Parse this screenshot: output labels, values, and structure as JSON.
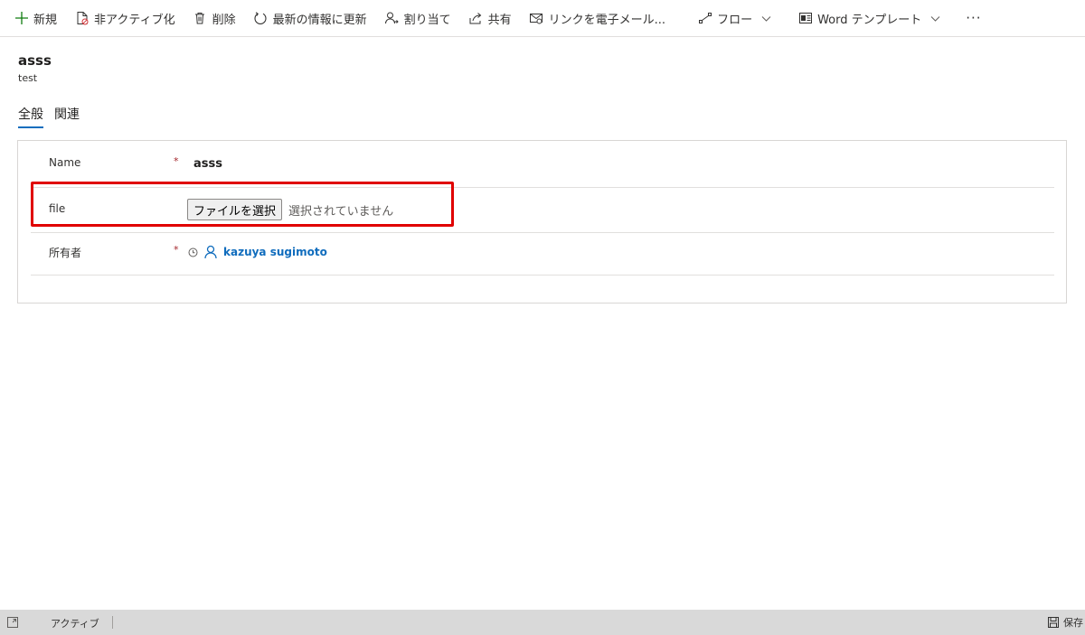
{
  "toolbar": {
    "new_label": "新規",
    "deactivate_label": "非アクティブ化",
    "delete_label": "削除",
    "refresh_label": "最新の情報に更新",
    "assign_label": "割り当て",
    "share_label": "共有",
    "email_link_label": "リンクを電子メール...",
    "flow_label": "フロー",
    "word_template_label": "Word テンプレート",
    "more_label": "···"
  },
  "record": {
    "title": "asss",
    "subtitle": "test"
  },
  "tabs": [
    {
      "label": "全般",
      "active": true
    },
    {
      "label": "関連",
      "active": false
    }
  ],
  "form": {
    "name": {
      "label": "Name",
      "required_mark": "*",
      "value": "asss"
    },
    "file": {
      "label": "file",
      "button_label": "ファイルを選択",
      "status": "選択されていません"
    },
    "owner": {
      "label": "所有者",
      "required_mark": "*",
      "value": "kazuya sugimoto"
    }
  },
  "statusbar": {
    "status": "アクティブ",
    "save_label": "保存"
  },
  "colors": {
    "accent": "#0f6cbd",
    "highlight": "#e00000",
    "required": "#a4262c",
    "statusbar_bg": "#d9d9d9"
  }
}
